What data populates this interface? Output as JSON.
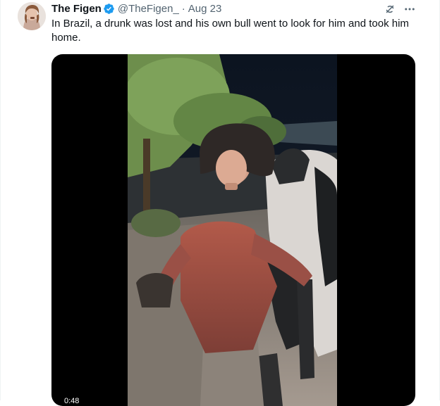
{
  "tweet": {
    "author_name": "The Figen",
    "author_handle": "@TheFigen_",
    "separator": "·",
    "date": "Aug 23",
    "text": "In Brazil, a drunk was lost and his own bull went to look for him and took him home.",
    "icons": {
      "verified": "verified-badge-icon",
      "grok": "grok-icon",
      "more": "more-icon"
    },
    "colors": {
      "verified": "#1d9bf0",
      "secondary_text": "#536471"
    }
  },
  "video": {
    "duration": "0:48"
  }
}
